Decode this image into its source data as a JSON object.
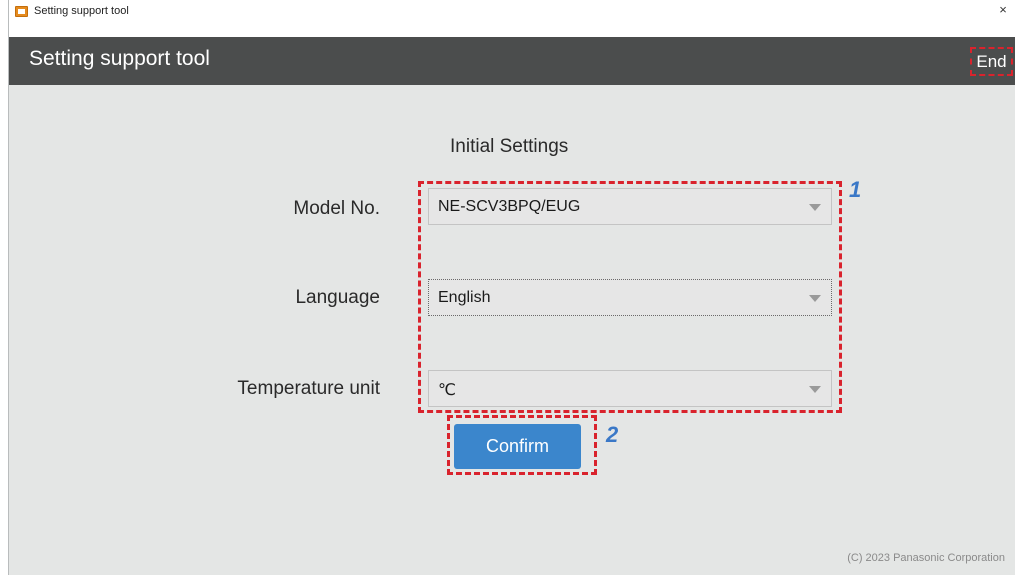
{
  "window": {
    "title": "Setting support tool",
    "close_glyph": "×"
  },
  "header": {
    "title": "Setting support tool",
    "end_label": "End"
  },
  "main": {
    "section_title": "Initial Settings",
    "fields": {
      "model": {
        "label": "Model No.",
        "value": "NE-SCV3BPQ/EUG"
      },
      "language": {
        "label": "Language",
        "value": "English"
      },
      "temperature": {
        "label": "Temperature unit",
        "value": "℃"
      }
    },
    "confirm_label": "Confirm",
    "steps": {
      "one": "1",
      "two": "2"
    }
  },
  "footer": {
    "copyright": "(C) 2023 Panasonic Corporation"
  },
  "colors": {
    "header_bg": "#4b4d4d",
    "content_bg": "#e4e6e5",
    "accent_button": "#3b86cc",
    "highlight_dash": "#d9232d",
    "step_number": "#3a78c7"
  },
  "icons": {
    "app": "app-window-icon",
    "close": "close-icon",
    "dropdown": "chevron-down-icon"
  }
}
